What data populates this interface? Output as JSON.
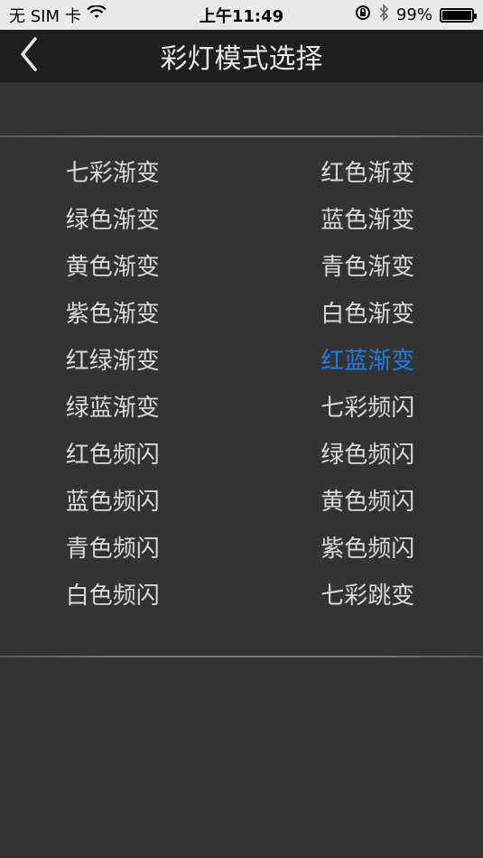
{
  "status_bar": {
    "carrier": "无 SIM 卡",
    "time": "上午11:49",
    "battery": "99%",
    "battery_level": 0.99
  },
  "nav": {
    "title": "彩灯模式选择",
    "back_icon": "chevron-left-icon"
  },
  "colors": {
    "background": "#333333",
    "navbar": "#1f1f1f",
    "text": "#d9d9d9",
    "selected": "#1c7ee3"
  },
  "modes": [
    {
      "label": "七彩渐变",
      "selected": false
    },
    {
      "label": "红色渐变",
      "selected": false
    },
    {
      "label": "绿色渐变",
      "selected": false
    },
    {
      "label": "蓝色渐变",
      "selected": false
    },
    {
      "label": "黄色渐变",
      "selected": false
    },
    {
      "label": "青色渐变",
      "selected": false
    },
    {
      "label": "紫色渐变",
      "selected": false
    },
    {
      "label": "白色渐变",
      "selected": false
    },
    {
      "label": "红绿渐变",
      "selected": false
    },
    {
      "label": "红蓝渐变",
      "selected": true
    },
    {
      "label": "绿蓝渐变",
      "selected": false
    },
    {
      "label": "七彩频闪",
      "selected": false
    },
    {
      "label": "红色频闪",
      "selected": false
    },
    {
      "label": "绿色频闪",
      "selected": false
    },
    {
      "label": "蓝色频闪",
      "selected": false
    },
    {
      "label": "黄色频闪",
      "selected": false
    },
    {
      "label": "青色频闪",
      "selected": false
    },
    {
      "label": "紫色频闪",
      "selected": false
    },
    {
      "label": "白色频闪",
      "selected": false
    },
    {
      "label": "七彩跳变",
      "selected": false
    }
  ]
}
